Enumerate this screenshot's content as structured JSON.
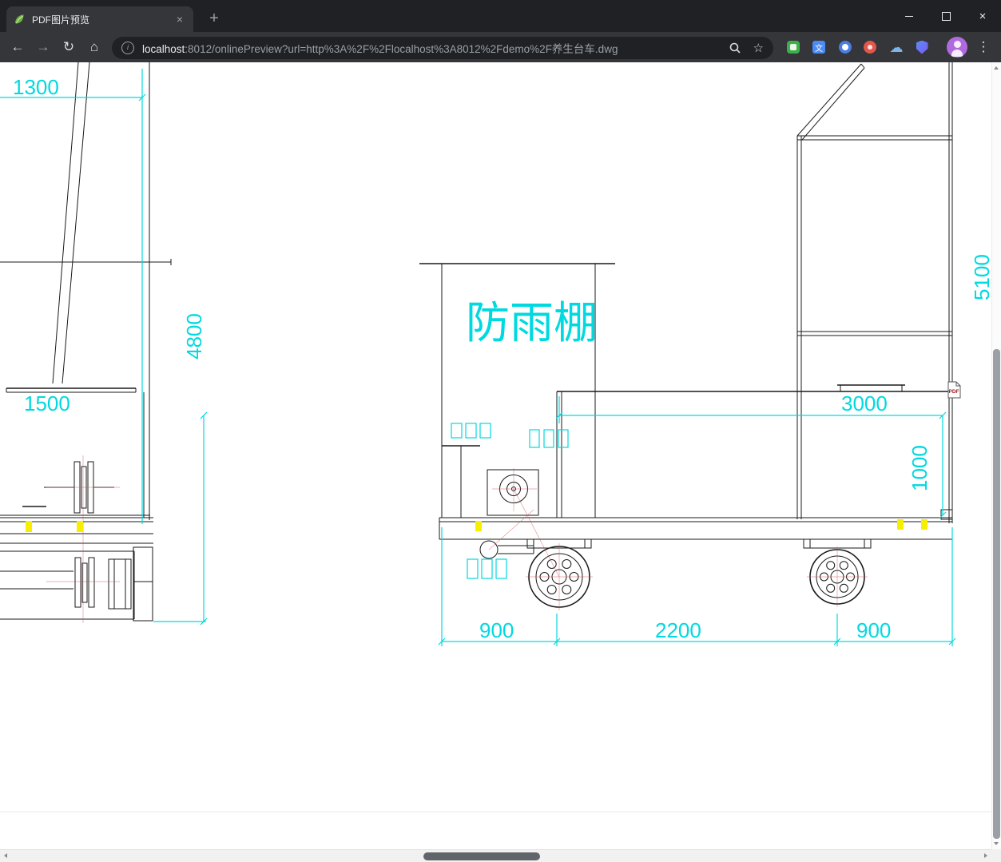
{
  "window": {
    "close_glyph": "×"
  },
  "tab": {
    "title": "PDF图片预览",
    "close_glyph": "×",
    "new_tab_glyph": "+"
  },
  "toolbar": {
    "back_glyph": "←",
    "forward_glyph": "→",
    "reload_glyph": "↻",
    "home_glyph": "⌂",
    "info_glyph": "i",
    "star_glyph": "☆",
    "menu_glyph": "⋮",
    "translate_glyph": "文",
    "cloud_glyph": "☁",
    "url": {
      "host": "localhost",
      "rest": ":8012/onlinePreview?url=http%3A%2F%2Flocalhost%3A8012%2Fdemo%2F养生台车.dwg"
    }
  },
  "drawing": {
    "labels": {
      "dim_1300": "1300",
      "dim_4800": "4800",
      "dim_1500": "1500",
      "shelter": "防雨棚",
      "dim_5100": "5100",
      "dim_3000": "3000",
      "dim_1000": "1000",
      "dim_900_left": "900",
      "dim_2200": "2200",
      "dim_900_right": "900",
      "pdf_badge": "PDF"
    },
    "colors": {
      "dimension_cyan": "#00d9e0",
      "line_black": "#1a1a1a",
      "highlight_yellow": "#f7ee00",
      "construction_red": "#cc4455"
    }
  }
}
